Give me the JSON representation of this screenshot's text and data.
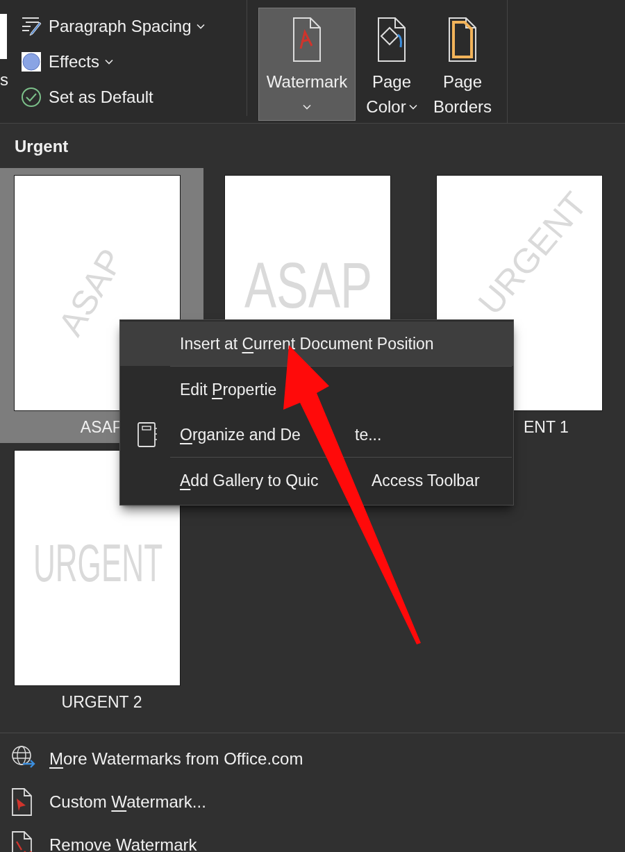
{
  "ribbon": {
    "cut_label": "s",
    "left_group": [
      {
        "kind": "spacing",
        "label": "Paragraph Spacing",
        "dropdown": true
      },
      {
        "kind": "effects",
        "label": "Effects",
        "dropdown": true
      },
      {
        "kind": "default",
        "label": "Set as Default",
        "dropdown": false
      }
    ],
    "buttons": [
      {
        "kind": "watermark",
        "lines": [
          "Watermark"
        ],
        "dropdown": true,
        "selected": true
      },
      {
        "kind": "page_color",
        "lines": [
          "Page",
          "Color"
        ],
        "dropdown": true,
        "selected": false
      },
      {
        "kind": "page_borders",
        "lines": [
          "Page",
          "Borders"
        ],
        "dropdown": false,
        "selected": false
      }
    ]
  },
  "gallery": {
    "heading": "Urgent",
    "items": [
      {
        "label": "ASAP",
        "preview": "ASAP",
        "kind": "diagonal",
        "selected": true
      },
      {
        "preview": "ASAP",
        "kind": "horizontal",
        "selected": false
      },
      {
        "label": "ENT 1",
        "preview": "URGENT",
        "kind": "diagonal",
        "selected": false,
        "label_covered": true
      },
      {
        "label": "URGENT 2",
        "preview": "URGENT",
        "kind": "horizontal",
        "selected": false
      }
    ]
  },
  "context_menu": {
    "items": [
      {
        "before": "Insert at ",
        "key": "C",
        "after": "urrent Document Position",
        "highlighted": true,
        "icon": false
      },
      {
        "before": "Edit ",
        "key": "P",
        "after": "ropertie",
        "highlighted": false,
        "icon": false
      },
      {
        "key": "O",
        "after": "rganize and De",
        "tail": "te...",
        "highlighted": false,
        "icon": true
      },
      {
        "key": "A",
        "after": "dd Gallery to Quic",
        "tail": "Access Toolbar",
        "highlighted": false,
        "icon": false
      }
    ]
  },
  "footer_items": [
    {
      "kind": "online",
      "key": "M",
      "after": "ore Watermarks from Office.com"
    },
    {
      "kind": "custom",
      "before": "Custom ",
      "key": "W",
      "after": "atermark..."
    },
    {
      "kind": "remove",
      "after": "Remove Watermark"
    }
  ]
}
